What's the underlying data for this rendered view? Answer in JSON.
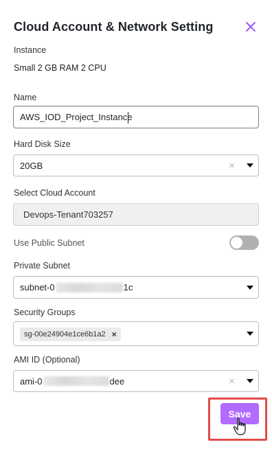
{
  "dialog": {
    "title": "Cloud Account & Network Setting",
    "accent_color": "#b26bff"
  },
  "instance": {
    "label": "Instance",
    "value": "Small 2 GB RAM 2 CPU"
  },
  "name": {
    "label": "Name",
    "value": "AWS_IOD_Project_Instance"
  },
  "disk": {
    "label": "Hard Disk Size",
    "value": "20GB"
  },
  "cloud_account": {
    "label": "Select Cloud Account",
    "value": "Devops-Tenant703257"
  },
  "public_subnet": {
    "label": "Use Public Subnet",
    "enabled": false
  },
  "private_subnet": {
    "label": "Private Subnet",
    "value_prefix": "subnet-0",
    "value_suffix": "1c"
  },
  "security_groups": {
    "label": "Security Groups",
    "chips": [
      "sg-00e24904e1ce6b1a2"
    ],
    "chip_remove": "×"
  },
  "ami": {
    "label": "AMI ID (Optional)",
    "value_prefix": "ami-0",
    "value_suffix": "dee"
  },
  "actions": {
    "save_label": "Save"
  },
  "icons": {
    "close": "close-icon",
    "clear": "×",
    "dropdown": "chevron-down-icon"
  }
}
